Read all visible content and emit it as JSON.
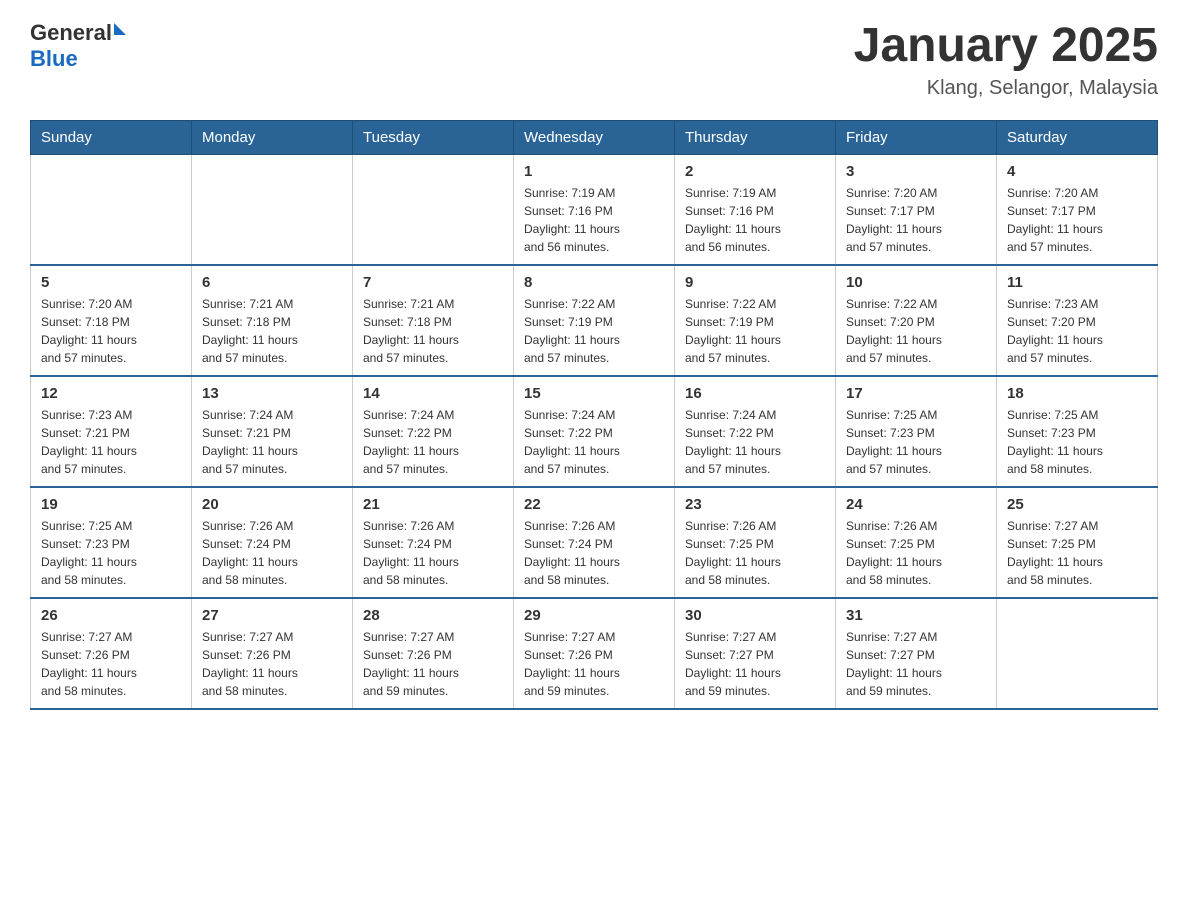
{
  "logo": {
    "general": "General",
    "triangle": "",
    "blue": "Blue"
  },
  "title": "January 2025",
  "location": "Klang, Selangor, Malaysia",
  "days_of_week": [
    "Sunday",
    "Monday",
    "Tuesday",
    "Wednesday",
    "Thursday",
    "Friday",
    "Saturday"
  ],
  "weeks": [
    [
      {
        "day": "",
        "info": ""
      },
      {
        "day": "",
        "info": ""
      },
      {
        "day": "",
        "info": ""
      },
      {
        "day": "1",
        "info": "Sunrise: 7:19 AM\nSunset: 7:16 PM\nDaylight: 11 hours\nand 56 minutes."
      },
      {
        "day": "2",
        "info": "Sunrise: 7:19 AM\nSunset: 7:16 PM\nDaylight: 11 hours\nand 56 minutes."
      },
      {
        "day": "3",
        "info": "Sunrise: 7:20 AM\nSunset: 7:17 PM\nDaylight: 11 hours\nand 57 minutes."
      },
      {
        "day": "4",
        "info": "Sunrise: 7:20 AM\nSunset: 7:17 PM\nDaylight: 11 hours\nand 57 minutes."
      }
    ],
    [
      {
        "day": "5",
        "info": "Sunrise: 7:20 AM\nSunset: 7:18 PM\nDaylight: 11 hours\nand 57 minutes."
      },
      {
        "day": "6",
        "info": "Sunrise: 7:21 AM\nSunset: 7:18 PM\nDaylight: 11 hours\nand 57 minutes."
      },
      {
        "day": "7",
        "info": "Sunrise: 7:21 AM\nSunset: 7:18 PM\nDaylight: 11 hours\nand 57 minutes."
      },
      {
        "day": "8",
        "info": "Sunrise: 7:22 AM\nSunset: 7:19 PM\nDaylight: 11 hours\nand 57 minutes."
      },
      {
        "day": "9",
        "info": "Sunrise: 7:22 AM\nSunset: 7:19 PM\nDaylight: 11 hours\nand 57 minutes."
      },
      {
        "day": "10",
        "info": "Sunrise: 7:22 AM\nSunset: 7:20 PM\nDaylight: 11 hours\nand 57 minutes."
      },
      {
        "day": "11",
        "info": "Sunrise: 7:23 AM\nSunset: 7:20 PM\nDaylight: 11 hours\nand 57 minutes."
      }
    ],
    [
      {
        "day": "12",
        "info": "Sunrise: 7:23 AM\nSunset: 7:21 PM\nDaylight: 11 hours\nand 57 minutes."
      },
      {
        "day": "13",
        "info": "Sunrise: 7:24 AM\nSunset: 7:21 PM\nDaylight: 11 hours\nand 57 minutes."
      },
      {
        "day": "14",
        "info": "Sunrise: 7:24 AM\nSunset: 7:22 PM\nDaylight: 11 hours\nand 57 minutes."
      },
      {
        "day": "15",
        "info": "Sunrise: 7:24 AM\nSunset: 7:22 PM\nDaylight: 11 hours\nand 57 minutes."
      },
      {
        "day": "16",
        "info": "Sunrise: 7:24 AM\nSunset: 7:22 PM\nDaylight: 11 hours\nand 57 minutes."
      },
      {
        "day": "17",
        "info": "Sunrise: 7:25 AM\nSunset: 7:23 PM\nDaylight: 11 hours\nand 57 minutes."
      },
      {
        "day": "18",
        "info": "Sunrise: 7:25 AM\nSunset: 7:23 PM\nDaylight: 11 hours\nand 58 minutes."
      }
    ],
    [
      {
        "day": "19",
        "info": "Sunrise: 7:25 AM\nSunset: 7:23 PM\nDaylight: 11 hours\nand 58 minutes."
      },
      {
        "day": "20",
        "info": "Sunrise: 7:26 AM\nSunset: 7:24 PM\nDaylight: 11 hours\nand 58 minutes."
      },
      {
        "day": "21",
        "info": "Sunrise: 7:26 AM\nSunset: 7:24 PM\nDaylight: 11 hours\nand 58 minutes."
      },
      {
        "day": "22",
        "info": "Sunrise: 7:26 AM\nSunset: 7:24 PM\nDaylight: 11 hours\nand 58 minutes."
      },
      {
        "day": "23",
        "info": "Sunrise: 7:26 AM\nSunset: 7:25 PM\nDaylight: 11 hours\nand 58 minutes."
      },
      {
        "day": "24",
        "info": "Sunrise: 7:26 AM\nSunset: 7:25 PM\nDaylight: 11 hours\nand 58 minutes."
      },
      {
        "day": "25",
        "info": "Sunrise: 7:27 AM\nSunset: 7:25 PM\nDaylight: 11 hours\nand 58 minutes."
      }
    ],
    [
      {
        "day": "26",
        "info": "Sunrise: 7:27 AM\nSunset: 7:26 PM\nDaylight: 11 hours\nand 58 minutes."
      },
      {
        "day": "27",
        "info": "Sunrise: 7:27 AM\nSunset: 7:26 PM\nDaylight: 11 hours\nand 58 minutes."
      },
      {
        "day": "28",
        "info": "Sunrise: 7:27 AM\nSunset: 7:26 PM\nDaylight: 11 hours\nand 59 minutes."
      },
      {
        "day": "29",
        "info": "Sunrise: 7:27 AM\nSunset: 7:26 PM\nDaylight: 11 hours\nand 59 minutes."
      },
      {
        "day": "30",
        "info": "Sunrise: 7:27 AM\nSunset: 7:27 PM\nDaylight: 11 hours\nand 59 minutes."
      },
      {
        "day": "31",
        "info": "Sunrise: 7:27 AM\nSunset: 7:27 PM\nDaylight: 11 hours\nand 59 minutes."
      },
      {
        "day": "",
        "info": ""
      }
    ]
  ]
}
